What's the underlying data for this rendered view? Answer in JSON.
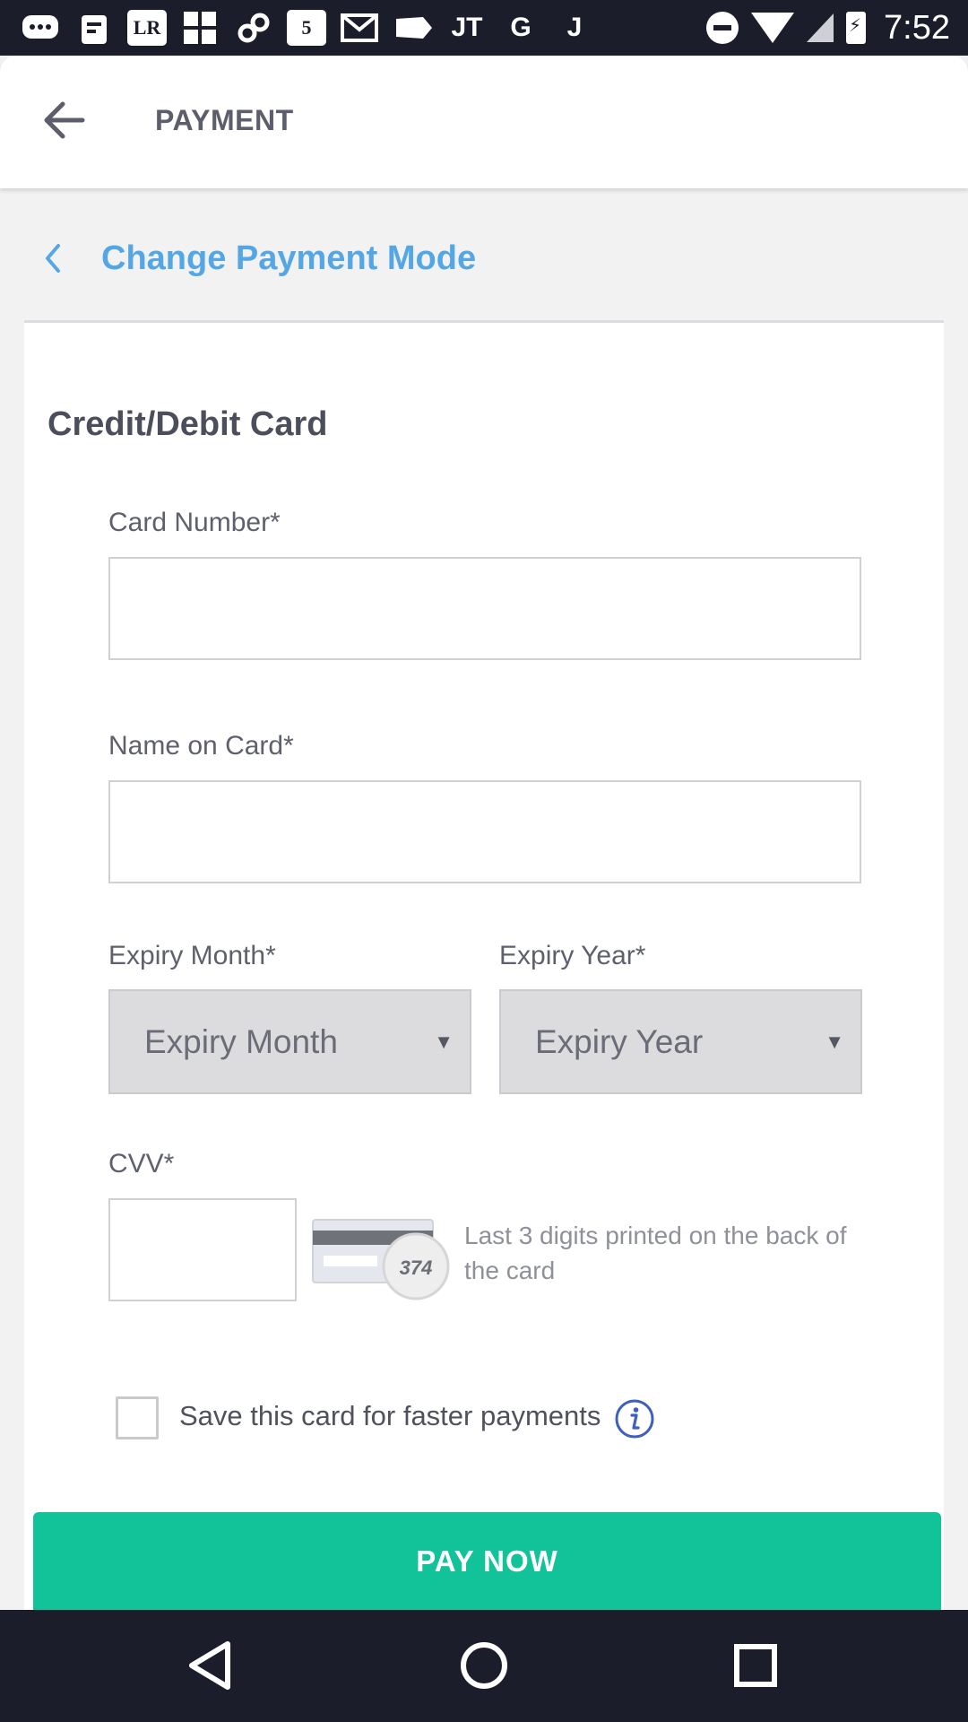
{
  "status_bar": {
    "time": "7:52",
    "left_icons": [
      "message-icon",
      "notification-icon",
      "lr-icon",
      "grid-icon",
      "link-icon",
      "five-icon",
      "gmail-icon",
      "tag-icon",
      "jt-icon",
      "google-icon",
      "j-icon"
    ],
    "lr_text": "LR",
    "five_text": "5",
    "google_text": "G",
    "j_text": "J",
    "jt_text": "JT"
  },
  "app_bar": {
    "title": "PAYMENT"
  },
  "change_payment": {
    "label": "Change Payment Mode"
  },
  "card_form": {
    "title": "Credit/Debit Card",
    "card_number": {
      "label": "Card Number*",
      "value": "",
      "placeholder": ""
    },
    "name_on_card": {
      "label": "Name on Card*",
      "value": "",
      "placeholder": ""
    },
    "expiry_month": {
      "label": "Expiry Month*",
      "selected": "Expiry Month"
    },
    "expiry_year": {
      "label": "Expiry Year*",
      "selected": "Expiry Year"
    },
    "cvv": {
      "label": "CVV*",
      "value": "",
      "sample_digits": "374",
      "hint": "Last 3 digits printed on the back of the card"
    },
    "save_card": {
      "label": "Save this card for faster payments",
      "checked": false
    }
  },
  "pay_button": {
    "label": "PAY NOW"
  },
  "colors": {
    "accent_blue": "#54a7e4",
    "pay_green": "#12c39a",
    "status_bar": "#1c1d2a",
    "info_icon": "#3f5fbf"
  }
}
